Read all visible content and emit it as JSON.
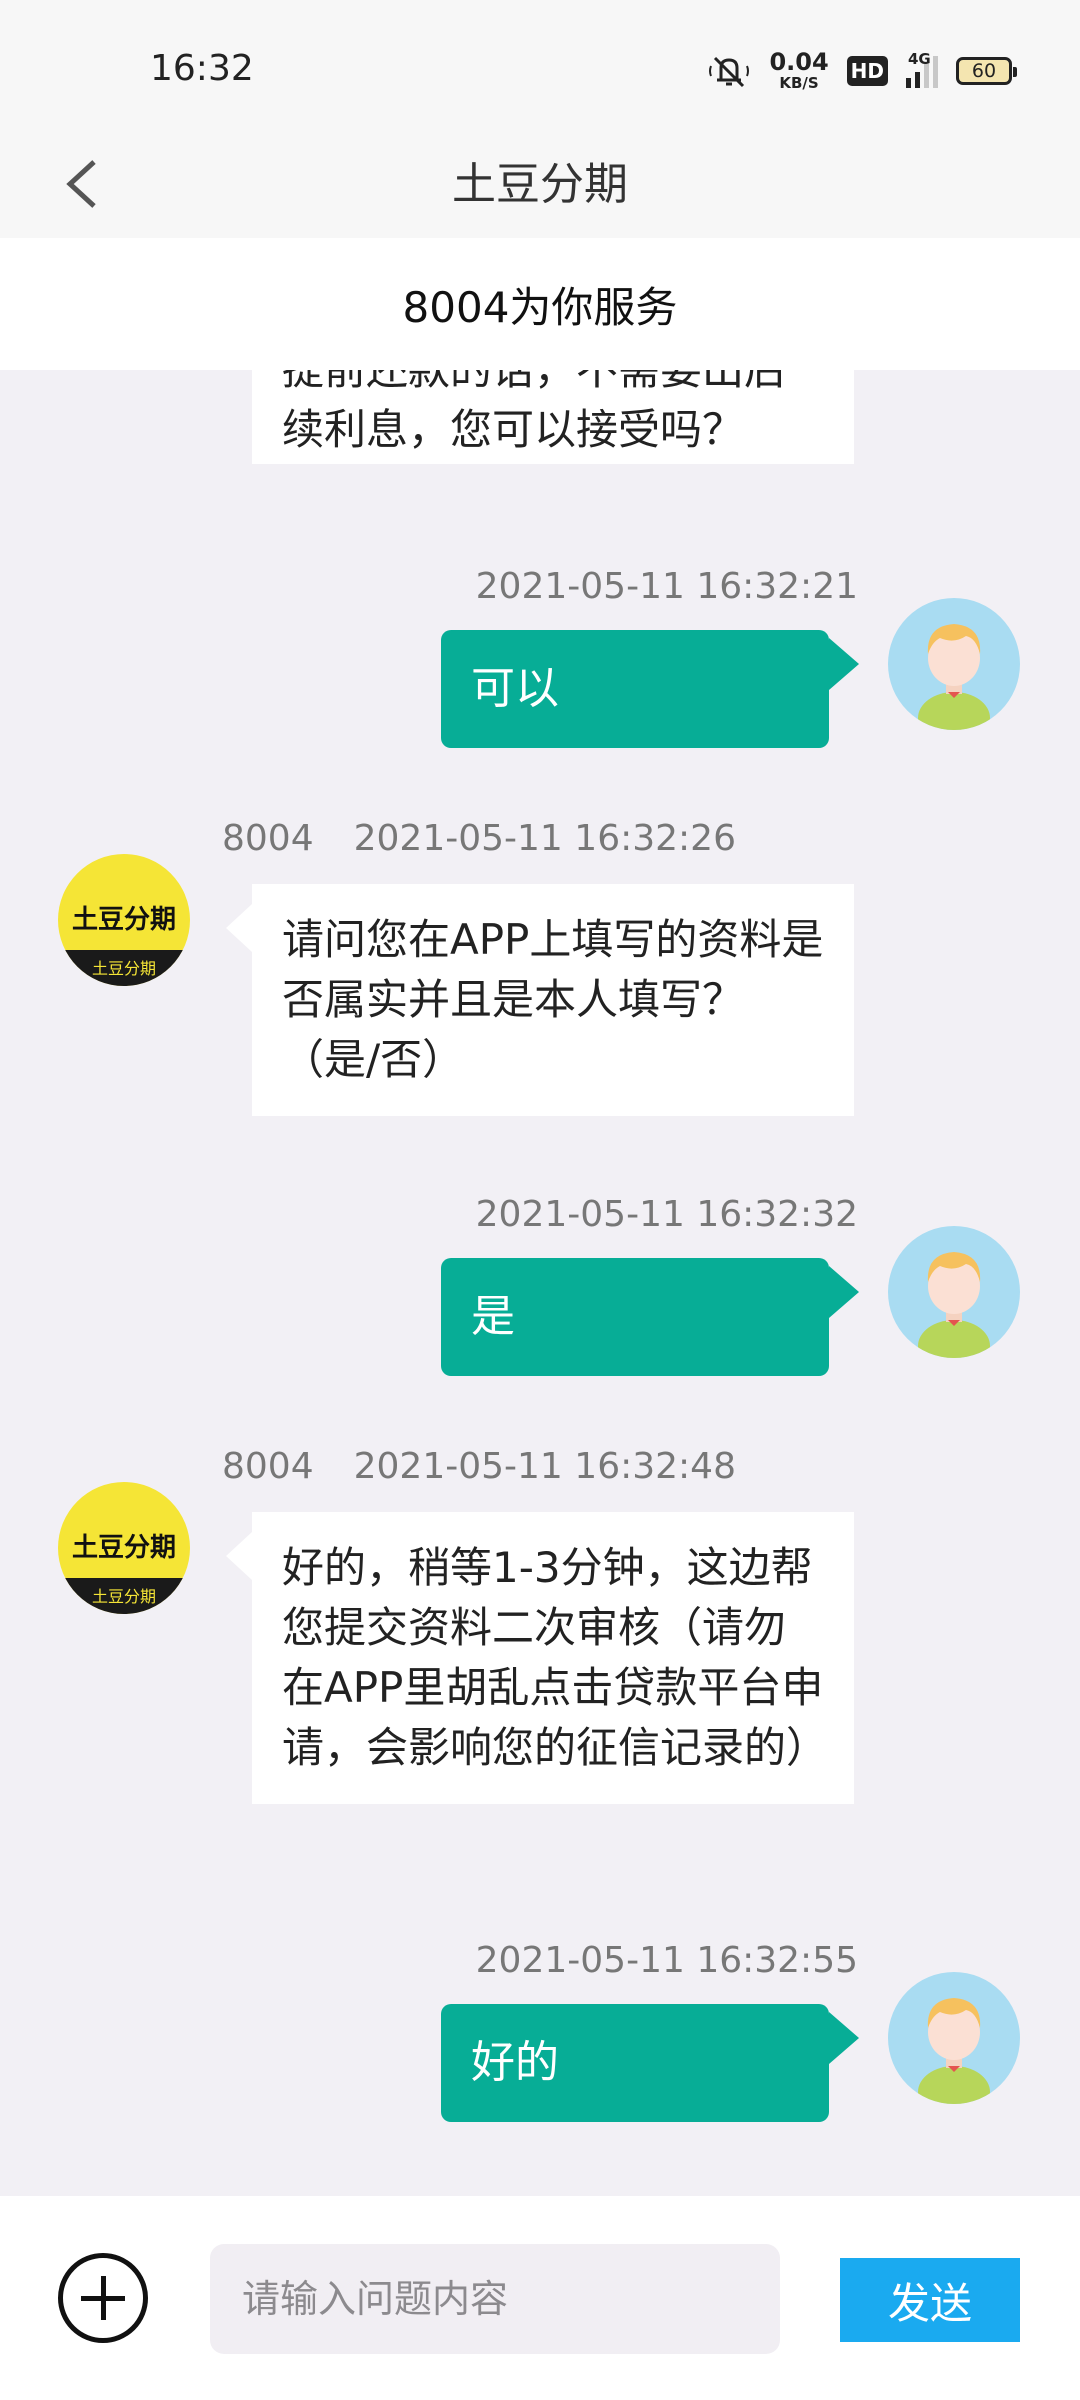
{
  "status_bar": {
    "time": "16:32",
    "net_speed": "0.04",
    "net_unit": "KB/S",
    "hd_badge": "HD",
    "network": "4G",
    "battery": "60"
  },
  "nav": {
    "title": "土豆分期",
    "back_icon": "chevron-left-icon"
  },
  "service_header": "8004为你服务",
  "bot_name": "8004",
  "messages": [
    {
      "from": "bot",
      "partial": true,
      "text_cut": "提前还款的话，不需要出后",
      "text": "续利息，您可以接受吗？"
    },
    {
      "from": "user",
      "time": "2021-05-11 16:32:21",
      "text": "可以"
    },
    {
      "from": "bot",
      "sender": "8004",
      "time": "2021-05-11 16:32:26",
      "text": "请问您在APP上填写的资料是否属实并且是本人填写？（是/否）"
    },
    {
      "from": "user",
      "time": "2021-05-11 16:32:32",
      "text": "是"
    },
    {
      "from": "bot",
      "sender": "8004",
      "time": "2021-05-11 16:32:48",
      "text": "好的，稍等1-3分钟，这边帮您提交资料二次审核（请勿在APP里胡乱点击贷款平台申请，会影响您的征信记录的）"
    },
    {
      "from": "user",
      "time": "2021-05-11 16:32:55",
      "text": "好的"
    }
  ],
  "bot_avatar": {
    "line1": "土豆分期",
    "line2": "土豆分期"
  },
  "input": {
    "placeholder": "请输入问题内容",
    "value": "",
    "send_label": "发送",
    "plus_icon": "plus-circle-icon"
  },
  "colors": {
    "user_bubble": "#07ad96",
    "send_button": "#1aaaf0",
    "chat_bg": "#f2f0f5"
  }
}
